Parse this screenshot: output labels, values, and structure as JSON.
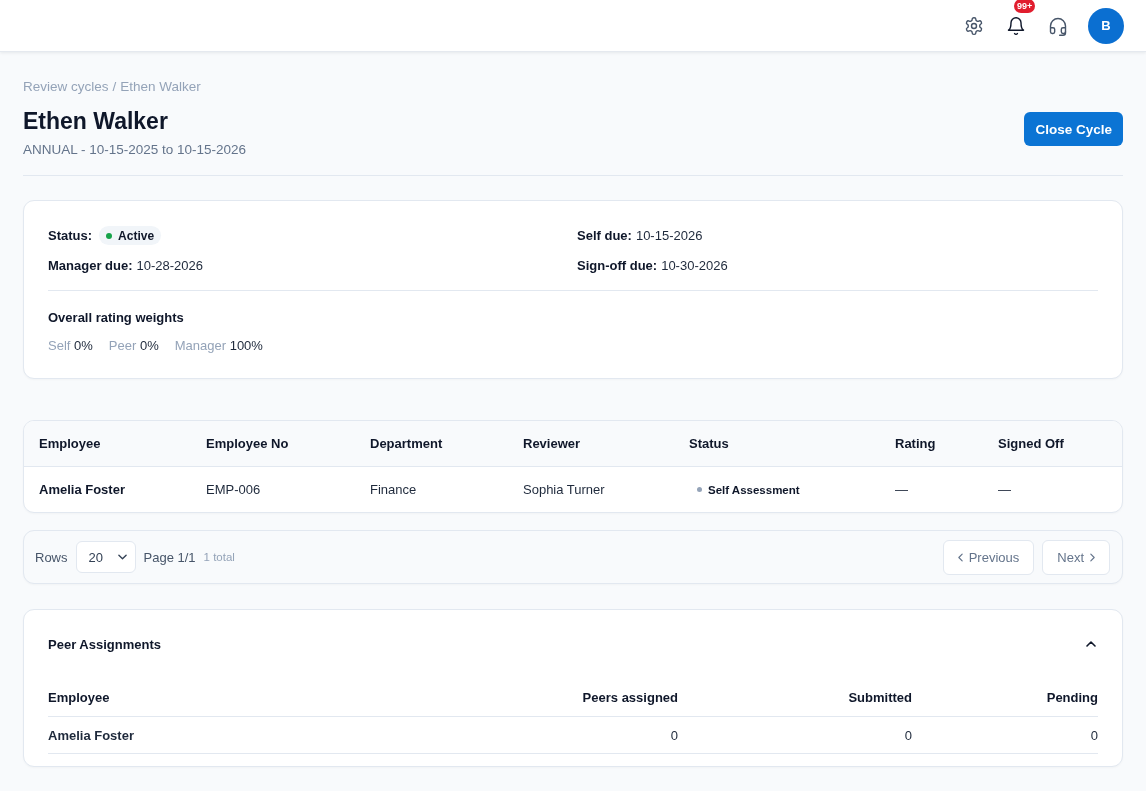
{
  "top_bar": {
    "notification_badge": "99+",
    "avatar_initial": "B"
  },
  "breadcrumb": {
    "items": [
      "Review cycles",
      "Ethen Walker"
    ],
    "separator": "/"
  },
  "header": {
    "title": "Ethen Walker",
    "subtitle": "ANNUAL - 10-15-2025 to 10-15-2026",
    "action": "Close Cycle"
  },
  "summary": {
    "fields": [
      {
        "label": "Status:",
        "kind": "badge",
        "value": "Active",
        "color": "#16a34a"
      },
      {
        "label": "Self due:",
        "kind": "text",
        "value": "10-15-2026"
      },
      {
        "label": "Manager due:",
        "kind": "text",
        "value": "10-28-2026"
      },
      {
        "label": "Sign-off due:",
        "kind": "text",
        "value": "10-30-2026"
      }
    ],
    "weights_title": "Overall rating weights",
    "weights": [
      {
        "label": "Self",
        "value": "0%"
      },
      {
        "label": "Peer",
        "value": "0%"
      },
      {
        "label": "Manager",
        "value": "100%"
      }
    ]
  },
  "table": {
    "columns": [
      "Employee",
      "Employee No",
      "Department",
      "Reviewer",
      "Status",
      "Rating",
      "Signed Off"
    ],
    "rows": [
      {
        "employee": "Amelia Foster",
        "employee_no": "EMP-006",
        "department": "Finance",
        "reviewer": "Sophia Turner",
        "status": {
          "label": "Self Assessment",
          "color": "#94a3b8"
        },
        "rating": "—",
        "signed_off": "—"
      }
    ]
  },
  "pagination": {
    "rows_label": "Rows",
    "page_size": "20",
    "page_info": "Page 1/1",
    "total": "1 total",
    "previous": {
      "label": "Previous",
      "disabled": true
    },
    "next": {
      "label": "Next",
      "disabled": true
    }
  },
  "peer_assignments": {
    "title": "Peer Assignments",
    "expanded": true,
    "columns": [
      "Employee",
      "Peers assigned",
      "Submitted",
      "Pending"
    ],
    "rows": [
      [
        "Amelia Foster",
        "0",
        "0",
        "0"
      ]
    ]
  }
}
